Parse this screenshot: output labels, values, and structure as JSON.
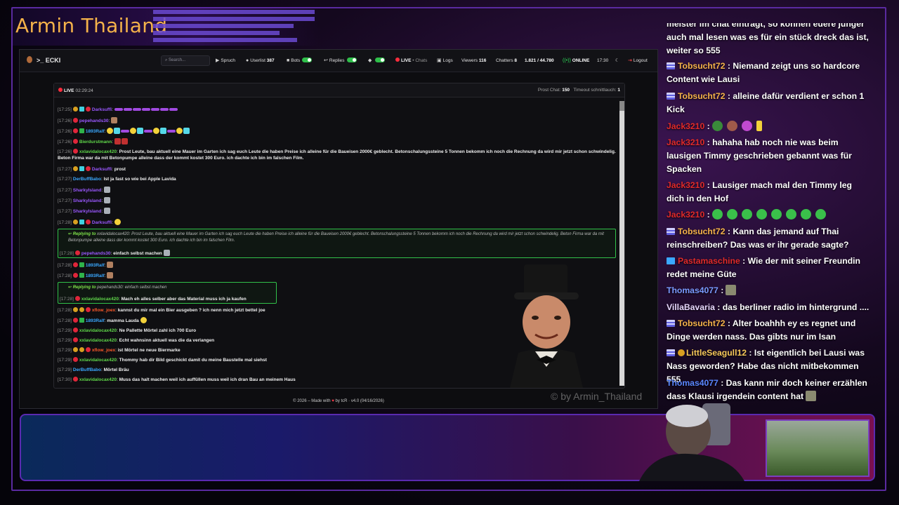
{
  "overlay": {
    "title": "Armin Thailand",
    "watermark": "© by Armin_Thailand"
  },
  "navbar": {
    "logo": ">_ ECKI",
    "search_placeholder": "Search...",
    "spruch": "Spruch",
    "userlist_label": "Userlist",
    "userlist_count": "387",
    "bots_label": "Bots",
    "replies_label": "Replies",
    "live_label": "LIVE",
    "chats_label": "• Chats",
    "logs_label": "Logs",
    "viewers_label": "Viewers",
    "viewers_count": "116",
    "chatters_label": "Chatters",
    "chatters_count": "8",
    "ratio": "1.821 / 44.780",
    "online": "ONLINE",
    "clock": "17:30",
    "logout": "Logout"
  },
  "chat": {
    "live": "LIVE",
    "duration": "02:29:24",
    "prost_label": "Prost Chat:",
    "prost_count": "150",
    "timeout_label": "Timeout schnittlauch:",
    "timeout_count": "1",
    "messages": [
      {
        "ts": "[17:25]",
        "user": "Darksuffi",
        "text": ""
      },
      {
        "ts": "[17:26]",
        "user": "pepehands30",
        "text": ""
      },
      {
        "ts": "[17:26]",
        "user": "1893Ralf",
        "text": ""
      },
      {
        "ts": "[17:26]",
        "user": "Bierdurstmann",
        "text": ""
      },
      {
        "ts": "[17:26]",
        "user": "xxlavidalocax420",
        "text": "Prost Leute, bau aktuell eine Mauer im Garten ich sag euch Leute die haben Preise ich alleine für die Baueisen 2000€ geblecht. Betonschalungssteine 5 Tonnen bekomm ich noch die Rechnung da wird mir jetzt schon schwindelig. Beton Firma war da mit Betonpumpe alleine dass der kommt kostet 300 Euro. ich dachte ich bin im falschen Film."
      },
      {
        "ts": "[17:27]",
        "user": "Darksuffi",
        "text": "prost"
      },
      {
        "ts": "[17:27]",
        "user": "DerBuffBabo",
        "text": "Ist ja fast so wie bei Apple Lavida"
      },
      {
        "ts": "[17:27]",
        "user": "SharkyIsland",
        "text": ""
      },
      {
        "ts": "[17:27]",
        "user": "SharkyIsland",
        "text": ""
      },
      {
        "ts": "[17:27]",
        "user": "SharkyIsland",
        "text": ""
      },
      {
        "ts": "[17:28]",
        "user": "Darksuffi",
        "text": ""
      },
      {
        "ts": "[17:28]",
        "user": "pepehands30",
        "text": "einfach selbst machen"
      },
      {
        "ts": "[17:28]",
        "user": "1893Ralf",
        "text": ""
      },
      {
        "ts": "[17:28]",
        "user": "1893Ralf",
        "text": ""
      },
      {
        "ts": "[17:28]",
        "user": "xxlavidalocax420",
        "text": "Mach eh alles selber aber das Material muss ich ja kaufen"
      },
      {
        "ts": "[17:28]",
        "user": "xflow_joex",
        "text": "kannst du mir mal ein Bier ausgeben ? ich nenn mich jetzt bettel joe"
      },
      {
        "ts": "[17:28]",
        "user": "1893Ralf",
        "text": "mamma Lauda"
      },
      {
        "ts": "[17:29]",
        "user": "xxlavidalocax420",
        "text": "Ne Pallette Mörtel zahl ich 700 Euro"
      },
      {
        "ts": "[17:29]",
        "user": "xxlavidalocax420",
        "text": "Echt wahnsinn aktuell was die da verlangen"
      },
      {
        "ts": "[17:29]",
        "user": "xflow_joex",
        "text": "ist Mörtel ne neue Biermarke"
      },
      {
        "ts": "[17:29]",
        "user": "xxlavidalocax420",
        "text": "Thommy hab dir Bild geschickt damit du meine Baustelle mal siehst"
      },
      {
        "ts": "[17:29]",
        "user": "DerBuffBabo",
        "text": "Mörtel Bräu"
      },
      {
        "ts": "[17:30]",
        "user": "xxlavidalocax420",
        "text": "Muss das halt machen weil ich auffüllen muss weil ich dran Bau an meinem Haus"
      }
    ],
    "reply1": {
      "label": "Replying to",
      "to": "xxlavidalocax420",
      "quoted": "Prost Leute, bau aktuell eine Mauer im Garten ich sag euch Leute die haben Preise ich alleine für die Baueisen 2000€ geblecht. Betonschalungssteine 5 Tonnen bekomm ich noch die Rechnung da wird mir jetzt schon schwindelig. Beton Firma war da mit Betonpumpe alleine dass der kommt kostet 300 Euro. ich dachte ich bin im falschen Film."
    },
    "reply2": {
      "label": "Replying to",
      "to": "pepehands30",
      "quoted": "einfach selbst machen"
    }
  },
  "footer": {
    "left": "© 2026 – Made with",
    "right": "by tcR · v4.0 (04/16/2026)"
  },
  "right_chat": [
    {
      "user": "",
      "text": "meister im chat einträgt, so können euere jünger auch mal lesen was es für ein stück dreck das ist, weiter so 555"
    },
    {
      "user": "Tobsucht72",
      "text": ": Niemand zeigt uns so hardcore Content wie Lausi"
    },
    {
      "user": "Tobsucht72",
      "text": ": alleine dafür verdient er schon 1 Kick"
    },
    {
      "user": "Jack3210",
      "text": ":"
    },
    {
      "user": "Jack3210",
      "text": ": hahaha hab noch nie was beim lausigen Timmy geschrieben gebannt was für Spacken"
    },
    {
      "user": "Jack3210",
      "text": ": Lausiger mach mal den Timmy leg dich in den Hof"
    },
    {
      "user": "Jack3210",
      "text": ":"
    },
    {
      "user": "Tobsucht72",
      "text": ": Kann das jemand auf Thai reinschreiben? Das was er ihr gerade sagte?"
    },
    {
      "user": "Pastamaschine",
      "text": ": Wie der mit seiner Freundin redet meine Güte"
    },
    {
      "user": "Thomas4077",
      "text": ":"
    },
    {
      "user": "VillaBavaria",
      "text": ": das berliner radio im hintergrund ...."
    },
    {
      "user": "Tobsucht72",
      "text": ": Alter boahhh ey es regnet und Dinge werden nass. Das gibts nur im Isan"
    },
    {
      "user": "LittleSeagull12",
      "text": ": Ist eigentlich bei Lausi was Nass geworden? Habe das nicht mitbekommen 555"
    },
    {
      "user": "Thomas4077",
      "text": ": Das kann mir doch keiner erzählen dass Klausi irgendein content hat"
    }
  ]
}
